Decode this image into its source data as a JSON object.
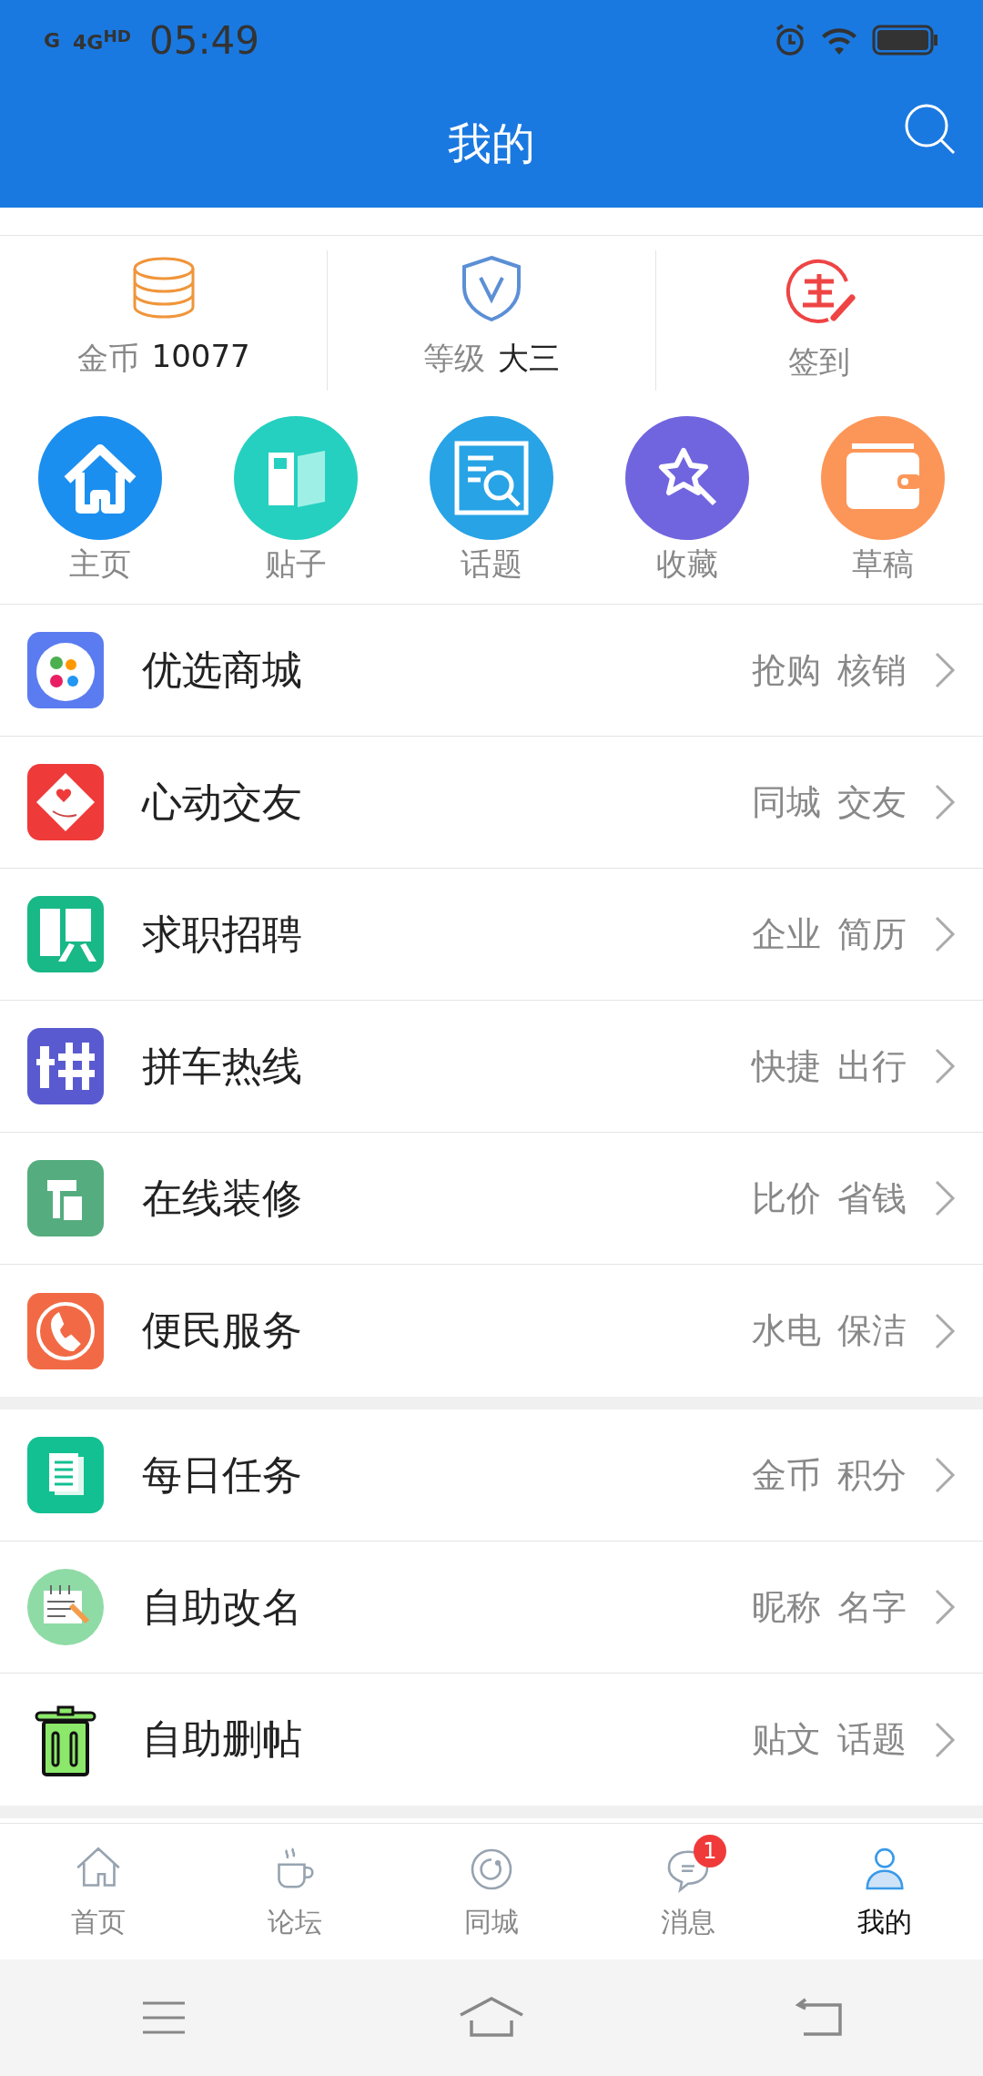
{
  "status_bar": {
    "networks": [
      "G",
      "4G$^{HD}$"
    ],
    "time": "05:49"
  },
  "header": {
    "title": "我的"
  },
  "stats": [
    {
      "label": "金币",
      "value": "10077"
    },
    {
      "label": "等级",
      "value": "大三"
    },
    {
      "label": "签到"
    }
  ],
  "shortcuts": [
    {
      "label": "主页",
      "color": "#1b8ff0"
    },
    {
      "label": "贴子",
      "color": "#25d0c0"
    },
    {
      "label": "话题",
      "color": "#27a3e6"
    },
    {
      "label": "收藏",
      "color": "#7165df"
    },
    {
      "label": "草稿",
      "color": "#fc9658"
    }
  ],
  "sections": [
    {
      "items": [
        {
          "title": "优选商城",
          "tags": [
            "抢购",
            "核销"
          ]
        },
        {
          "title": "心动交友",
          "tags": [
            "同城",
            "交友"
          ]
        },
        {
          "title": "求职招聘",
          "tags": [
            "企业",
            "简历"
          ]
        },
        {
          "title": "拼车热线",
          "tags": [
            "快捷",
            "出行"
          ]
        },
        {
          "title": "在线装修",
          "tags": [
            "比价",
            "省钱"
          ]
        },
        {
          "title": "便民服务",
          "tags": [
            "水电",
            "保洁"
          ]
        }
      ]
    },
    {
      "items": [
        {
          "title": "每日任务",
          "tags": [
            "金币",
            "积分"
          ]
        },
        {
          "title": "自助改名",
          "tags": [
            "昵称",
            "名字"
          ]
        },
        {
          "title": "自助删帖",
          "tags": [
            "贴文",
            "话题"
          ]
        }
      ]
    }
  ],
  "tab_bar": [
    {
      "label": "首页",
      "selected": false
    },
    {
      "label": "论坛",
      "selected": false
    },
    {
      "label": "同城",
      "selected": false
    },
    {
      "label": "消息",
      "selected": false,
      "badge": "1"
    },
    {
      "label": "我的",
      "selected": true
    }
  ]
}
